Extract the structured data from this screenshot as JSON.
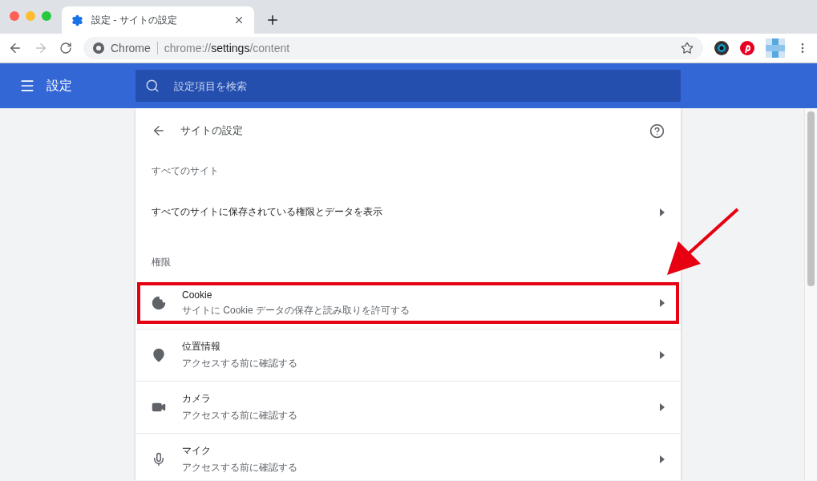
{
  "tab": {
    "title": "設定 - サイトの設定",
    "selected": true
  },
  "address": {
    "site_label": "Chrome",
    "url_prefix": "chrome://",
    "url_host": "settings",
    "url_path": "/content",
    "starred": false
  },
  "header": {
    "title": "設定",
    "search_placeholder": "設定項目を検索"
  },
  "page": {
    "title": "サイトの設定",
    "sections": [
      {
        "heading": "すべてのサイト",
        "items": [
          {
            "kind": "link",
            "label": "すべてのサイトに保存されている権限とデータを表示",
            "highlighted": false
          }
        ]
      },
      {
        "heading": "権限",
        "items": [
          {
            "kind": "cookie",
            "label": "Cookie",
            "description": "サイトに Cookie データの保存と読み取りを許可する",
            "highlighted": true
          },
          {
            "kind": "location",
            "label": "位置情報",
            "description": "アクセスする前に確認する",
            "highlighted": false
          },
          {
            "kind": "camera",
            "label": "カメラ",
            "description": "アクセスする前に確認する",
            "highlighted": false
          },
          {
            "kind": "mic",
            "label": "マイク",
            "description": "アクセスする前に確認する",
            "highlighted": false
          }
        ]
      }
    ]
  },
  "annotation_arrow": true
}
